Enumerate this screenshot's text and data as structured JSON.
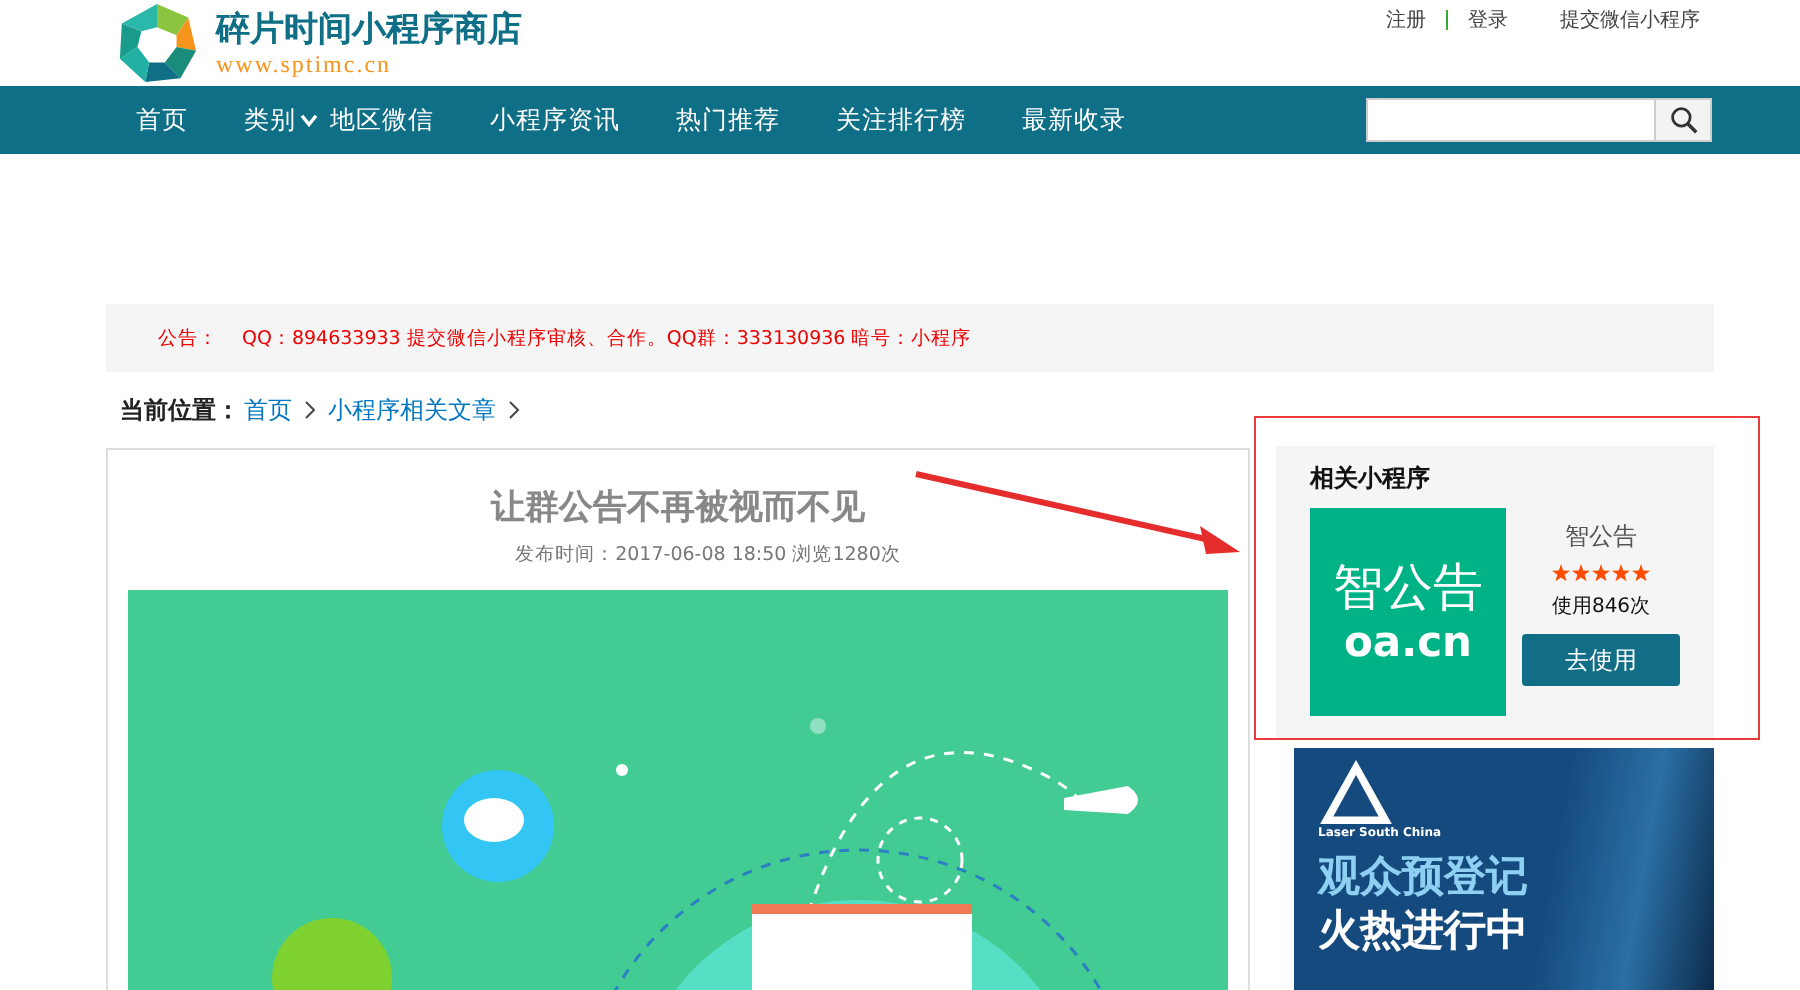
{
  "header": {
    "site_name": "碎片时间小程序商店",
    "site_url": "www.sptimc.cn",
    "links": [
      {
        "label": "注册"
      },
      {
        "label": "登录"
      },
      {
        "label": "提交微信小程序"
      }
    ]
  },
  "nav": {
    "items": [
      {
        "label": "首页",
        "has_dropdown": false
      },
      {
        "label": "类别",
        "has_dropdown": true
      },
      {
        "label": "地区微信",
        "has_dropdown": false
      },
      {
        "label": "小程序资讯",
        "has_dropdown": false
      },
      {
        "label": "热门推荐",
        "has_dropdown": false
      },
      {
        "label": "关注排行榜",
        "has_dropdown": false
      },
      {
        "label": "最新收录",
        "has_dropdown": false
      }
    ]
  },
  "notice": {
    "label": "公告：",
    "text": "QQ：894633933 提交微信小程序审核、合作。QQ群：333130936 暗号：小程序"
  },
  "breadcrumb": {
    "label": "当前位置：",
    "items": [
      {
        "label": "首页"
      },
      {
        "label": "小程序相关文章"
      }
    ]
  },
  "article": {
    "title": "让群公告不再被视而不见",
    "meta": "发布时间：2017-06-08 18:50  浏览1280次"
  },
  "sidebar": {
    "title": "相关小程序",
    "app": {
      "icon_text": "智公告",
      "icon_domain": "oa.cn",
      "name": "智公告",
      "stars": 5,
      "usage": "使用846次",
      "button": "去使用"
    },
    "banner": {
      "brand": "Laser South China",
      "line_1": "观众预登记",
      "line_2": "火热进行中"
    }
  }
}
